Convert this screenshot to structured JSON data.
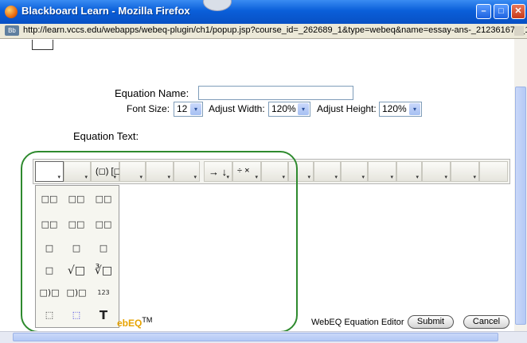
{
  "window": {
    "title": "Blackboard Learn - Mozilla Firefox",
    "url": "http://learn.vccs.edu/webapps/webeq-plugin/ch1/popup.jsp?course_id=_262689_1&type=webeq&name=essay-ans-_212361676_1text",
    "site_icon_label": "Bb",
    "minimize_glyph": "–",
    "maximize_glyph": "□",
    "close_glyph": "✕"
  },
  "form": {
    "equation_name_label": "Equation Name:",
    "equation_name_value": "",
    "font_size_label": "Font Size:",
    "font_size_value": "12",
    "adjust_width_label": "Adjust Width:",
    "adjust_width_value": "120%",
    "adjust_height_label": "Adjust Height:",
    "adjust_height_value": "120%",
    "equation_text_label": "Equation Text:"
  },
  "toolbar": {
    "paren_symbols": "(◻) [◻]",
    "arrow_symbols": "→ ↓",
    "op_symbols": "÷ ×",
    "dropdown_glyph": "▾"
  },
  "palette": {
    "cells": [
      "□□",
      "□□",
      "□□",
      "□□",
      "□□",
      "□□",
      "□",
      "□",
      "□",
      "□",
      "√□",
      "∛□",
      "□)□",
      "□)□",
      "123",
      "⬚",
      "⬚",
      "T"
    ]
  },
  "footer": {
    "logo_text": "ebEQ",
    "logo_tm": "TM",
    "editor_label": "WebEQ Equation Editor",
    "submit_label": "Submit",
    "cancel_label": "Cancel"
  },
  "colors": {
    "titlebar": "#0a5fd9",
    "highlight_oval": "#2e8a2e",
    "logo": "#e7a300"
  }
}
